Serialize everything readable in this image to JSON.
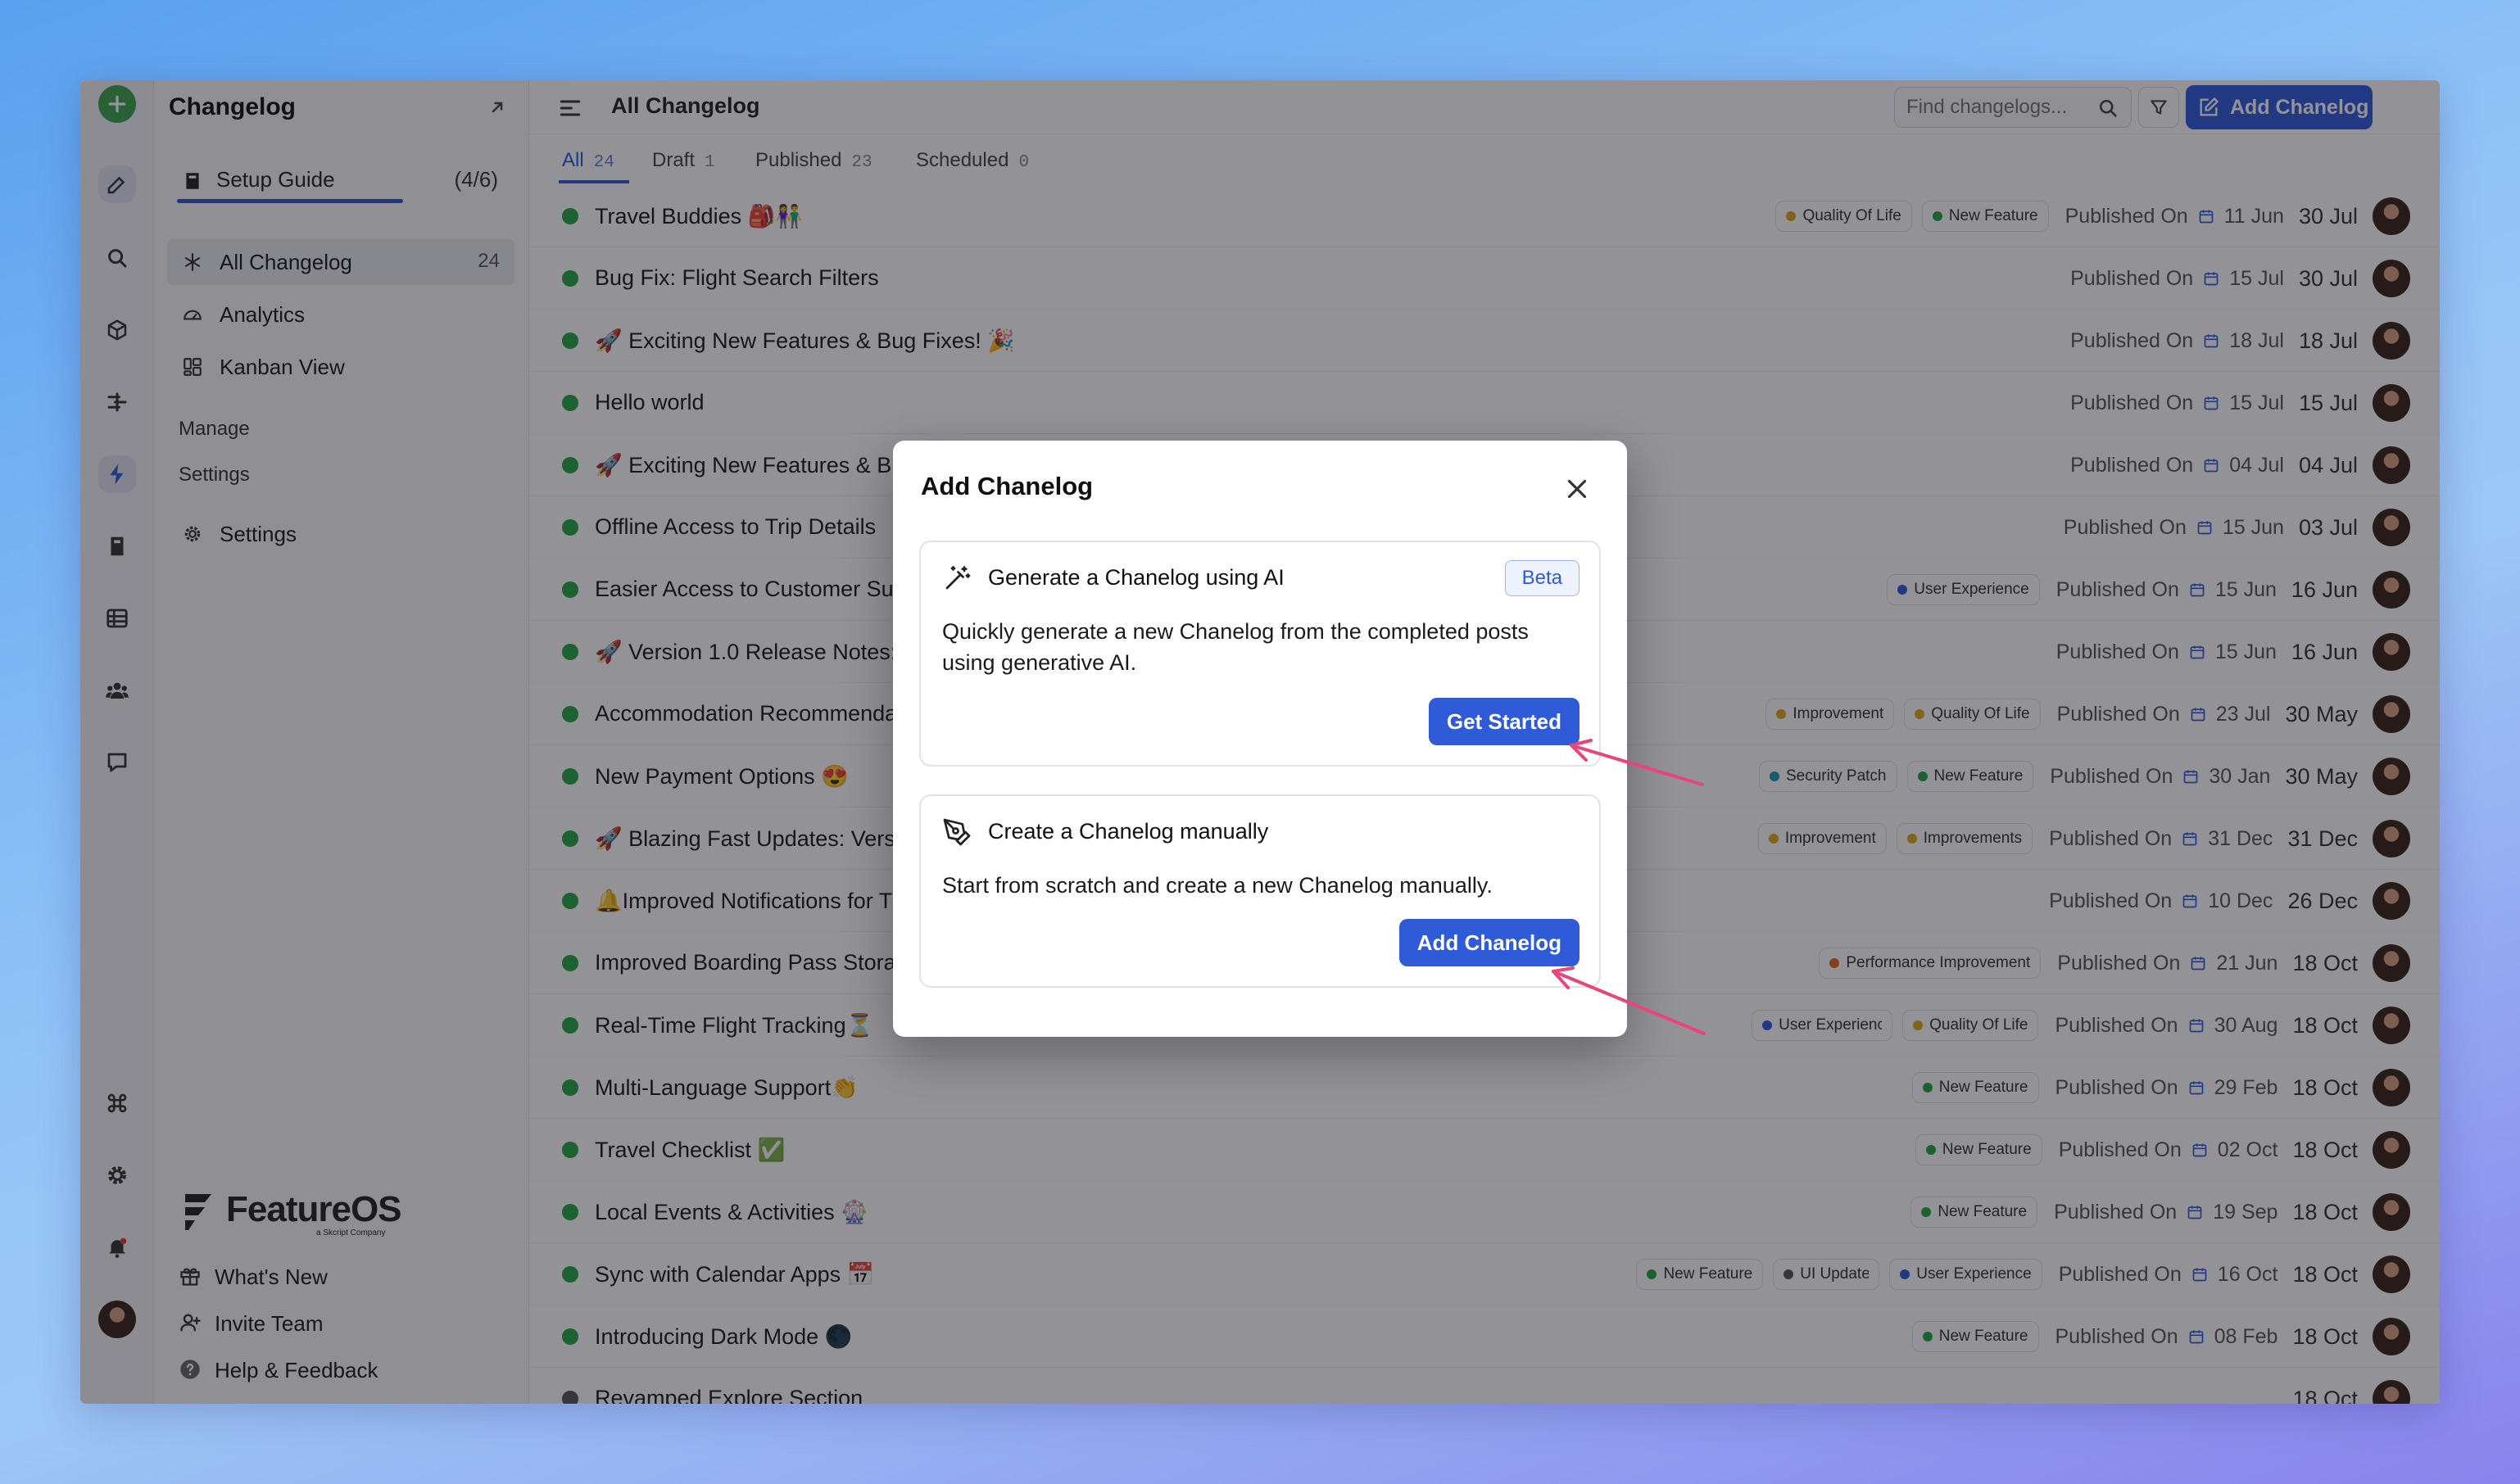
{
  "sidebar": {
    "title": "Changelog",
    "setup_guide": {
      "label": "Setup Guide",
      "progress": "(4/6)"
    },
    "nav": [
      {
        "label": "All Changelog",
        "count": "24"
      },
      {
        "label": "Analytics"
      },
      {
        "label": "Kanban View"
      }
    ],
    "sections": {
      "manage": "Manage",
      "settings": "Settings"
    },
    "settings_item": "Settings",
    "brand": {
      "name": "FeatureOS",
      "sub": "a Skcript Company"
    },
    "footer": [
      {
        "label": "What's New"
      },
      {
        "label": "Invite Team"
      },
      {
        "label": "Help & Feedback"
      }
    ]
  },
  "header": {
    "title": "All Changelog",
    "search_placeholder": "Find changelogs...",
    "add_button": "Add Chanelog"
  },
  "tabs": [
    {
      "label": "All",
      "count": "24"
    },
    {
      "label": "Draft",
      "count": "1"
    },
    {
      "label": "Published",
      "count": "23"
    },
    {
      "label": "Scheduled",
      "count": "0"
    }
  ],
  "colors": {
    "accent": "#2f5bd8",
    "published_dot": "#26a744",
    "scheduled_dot": "#555555"
  },
  "rows": [
    {
      "title": "Travel Buddies 🎒👫",
      "tags": [
        {
          "label": "Quality Of Life",
          "color": "#e0a81c"
        },
        {
          "label": "New Feature",
          "color": "#26a744"
        }
      ],
      "published": "Published On",
      "date1": "11 Jun",
      "date2": "30 Jul"
    },
    {
      "title": "Bug Fix: Flight Search Filters",
      "tags": [],
      "published": "Published On",
      "date1": "15 Jul",
      "date2": "30 Jul"
    },
    {
      "title": "🚀 Exciting New Features & Bug Fixes! 🎉",
      "tags": [],
      "published": "Published On",
      "date1": "18 Jul",
      "date2": "18 Jul"
    },
    {
      "title": "Hello world",
      "tags": [],
      "published": "Published On",
      "date1": "15 Jul",
      "date2": "15 Jul"
    },
    {
      "title": "🚀 Exciting New Features & Bug Fixes!",
      "tags": [],
      "published": "Published On",
      "date1": "04 Jul",
      "date2": "04 Jul"
    },
    {
      "title": "Offline Access to Trip Details",
      "tags": [],
      "published": "Published On",
      "date1": "15 Jun",
      "date2": "03 Jul"
    },
    {
      "title": "Easier Access to Customer Support",
      "tags": [
        {
          "label": "User Experience",
          "color": "#2f5bd8"
        }
      ],
      "published": "Published On",
      "date1": "15 Jun",
      "date2": "16 Jun"
    },
    {
      "title": "🚀 Version 1.0 Release Notes: ",
      "tags": [],
      "published": "Published On",
      "date1": "15 Jun",
      "date2": "16 Jun"
    },
    {
      "title": "Accommodation Recommendations",
      "tags": [
        {
          "label": "Improvement",
          "color": "#e0a81c"
        },
        {
          "label": "Quality Of Life",
          "color": "#e0a81c"
        }
      ],
      "published": "Published On",
      "date1": "23 Jul",
      "date2": "30 May"
    },
    {
      "title": "New Payment Options 😍",
      "tags": [
        {
          "label": "Security Patch",
          "color": "#1d9bb8"
        },
        {
          "label": "New Feature",
          "color": "#26a744"
        }
      ],
      "published": "Published On",
      "date1": "30 Jan",
      "date2": "30 May"
    },
    {
      "title": "🚀 Blazing Fast Updates: Version",
      "tags": [
        {
          "label": "Improvement",
          "color": "#e0a81c"
        },
        {
          "label": "Improvements",
          "color": "#e0a81c"
        }
      ],
      "published": "Published On",
      "date1": "31 Dec",
      "date2": "31 Dec"
    },
    {
      "title": "🔔Improved Notifications for Travelers",
      "tags": [],
      "published": "Published On",
      "date1": "10 Dec",
      "date2": "26 Dec"
    },
    {
      "title": "Improved Boarding Pass Storage",
      "tags": [
        {
          "label": "Performance Improvement",
          "color": "#e06a1c"
        }
      ],
      "published": "Published On",
      "date1": "21 Jun",
      "date2": "18 Oct"
    },
    {
      "title": "Real-Time Flight Tracking⏳",
      "tags": [
        {
          "label": "User Experience",
          "color": "#2f5bd8"
        },
        {
          "label": "Quality Of Life",
          "color": "#e0a81c"
        }
      ],
      "published": "Published On",
      "date1": "30 Aug",
      "date2": "18 Oct"
    },
    {
      "title": "Multi-Language Support👏",
      "tags": [
        {
          "label": "New Feature",
          "color": "#26a744"
        }
      ],
      "published": "Published On",
      "date1": "29 Feb",
      "date2": "18 Oct"
    },
    {
      "title": "Travel Checklist ✅",
      "tags": [
        {
          "label": "New Feature",
          "color": "#26a744"
        }
      ],
      "published": "Published On",
      "date1": "02 Oct",
      "date2": "18 Oct"
    },
    {
      "title": "Local Events & Activities 🎡",
      "tags": [
        {
          "label": "New Feature",
          "color": "#26a744"
        }
      ],
      "published": "Published On",
      "date1": "19 Sep",
      "date2": "18 Oct"
    },
    {
      "title": "Sync with Calendar Apps 📅",
      "tags": [
        {
          "label": "New Feature",
          "color": "#26a744"
        },
        {
          "label": "UI Update",
          "color": "#555555"
        },
        {
          "label": "User Experience",
          "color": "#2f5bd8"
        }
      ],
      "published": "Published On",
      "date1": "16 Oct",
      "date2": "18 Oct"
    },
    {
      "title": "Introducing Dark Mode 🌑",
      "tags": [
        {
          "label": "New Feature",
          "color": "#26a744"
        }
      ],
      "published": "Published On",
      "date1": "08 Feb",
      "date2": "18 Oct"
    },
    {
      "title": "Revamped Explore Section",
      "tags": [],
      "published": "",
      "date1": "",
      "date2": "18 Oct"
    }
  ],
  "modal": {
    "title": "Add Chanelog",
    "ai_card": {
      "title": "Generate a Chanelog using AI",
      "badge": "Beta",
      "description": "Quickly generate a new Chanelog from the completed posts using generative AI.",
      "button": "Get Started"
    },
    "manual_card": {
      "title": "Create a Chanelog manually",
      "description": "Start from scratch and create a new Chanelog manually.",
      "button": "Add Chanelog"
    }
  }
}
